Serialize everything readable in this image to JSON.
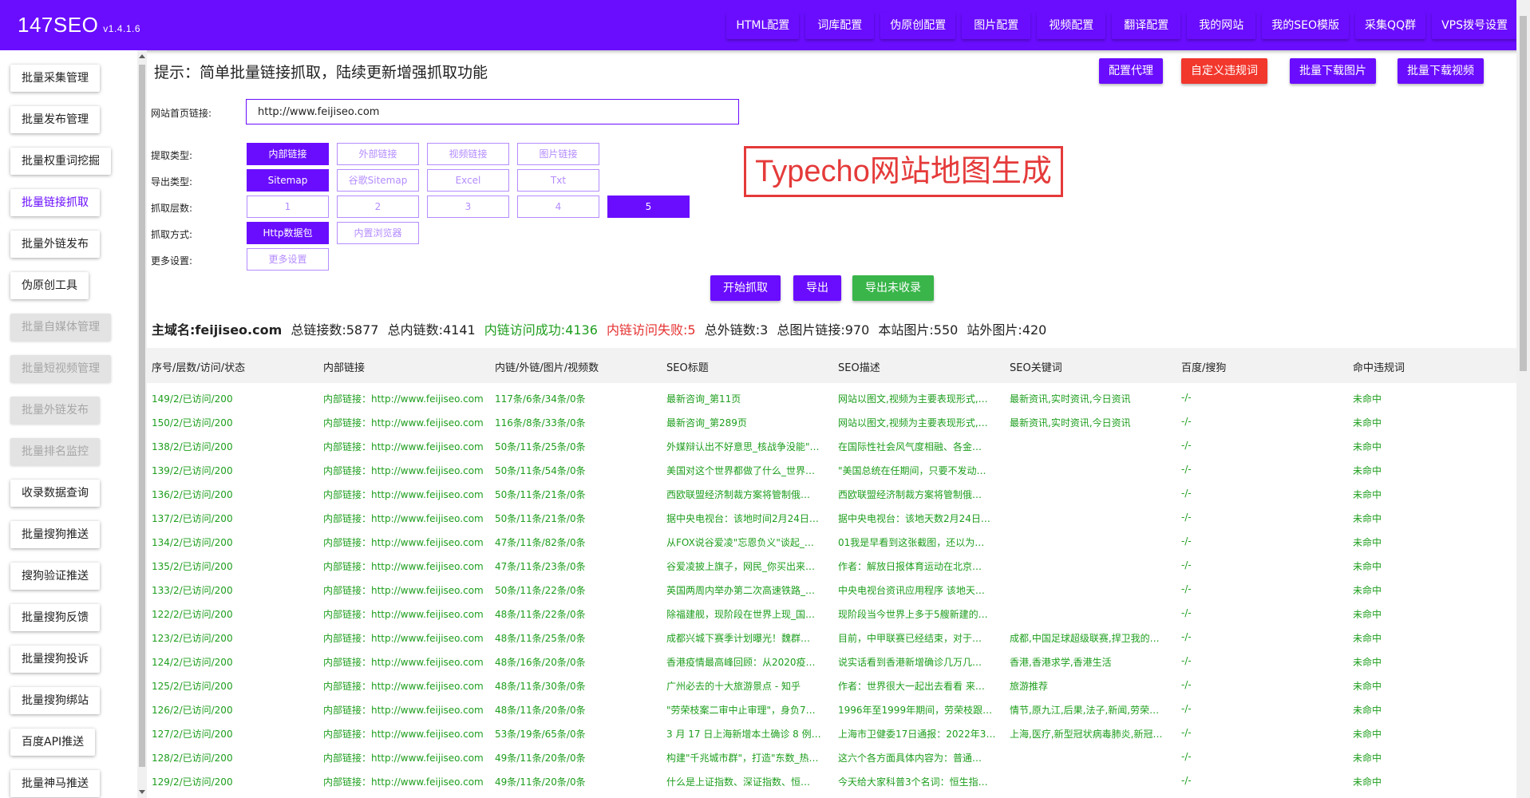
{
  "app": {
    "title": "147SEO",
    "version": "v1.4.1.6"
  },
  "topnav": [
    "HTML配置",
    "词库配置",
    "伪原创配置",
    "图片配置",
    "视频配置",
    "翻译配置",
    "我的网站",
    "我的SEO模版",
    "采集QQ群",
    "VPS拨号设置"
  ],
  "sidebar": {
    "items": [
      {
        "label": "批量采集管理",
        "state": "normal"
      },
      {
        "label": "批量发布管理",
        "state": "normal"
      },
      {
        "label": "批量权重词挖掘",
        "state": "normal"
      },
      {
        "label": "批量链接抓取",
        "state": "active"
      },
      {
        "label": "批量外链发布",
        "state": "normal"
      },
      {
        "label": "伪原创工具",
        "state": "normal"
      },
      {
        "label": "批量自媒体管理",
        "state": "disabled"
      },
      {
        "label": "批量短视频管理",
        "state": "disabled"
      },
      {
        "label": "批量外链发布",
        "state": "disabled"
      },
      {
        "label": "批量排名监控",
        "state": "disabled"
      },
      {
        "label": "收录数据查询",
        "state": "normal"
      },
      {
        "label": "批量搜狗推送",
        "state": "normal"
      },
      {
        "label": "搜狗验证推送",
        "state": "normal"
      },
      {
        "label": "批量搜狗反馈",
        "state": "normal"
      },
      {
        "label": "批量搜狗投诉",
        "state": "normal"
      },
      {
        "label": "批量搜狗绑站",
        "state": "normal"
      },
      {
        "label": "百度API推送",
        "state": "normal"
      },
      {
        "label": "批量神马推送",
        "state": "normal"
      }
    ]
  },
  "header": {
    "tip": "提示：简单批量链接抓取，陆续更新增强抓取功能",
    "actions": [
      "配置代理",
      "自定义违规词",
      "批量下载图片",
      "批量下载视频"
    ]
  },
  "form": {
    "url_label": "网站首页链接:",
    "url_value": "http://www.feijiseo.com",
    "extract_label": "提取类型:",
    "extract_options": [
      "内部链接",
      "外部链接",
      "视频链接",
      "图片链接"
    ],
    "export_label": "导出类型:",
    "export_options": [
      "Sitemap",
      "谷歌Sitemap",
      "Excel",
      "Txt"
    ],
    "depth_label": "抓取层数:",
    "depth_options": [
      "1",
      "2",
      "3",
      "4",
      "5"
    ],
    "method_label": "抓取方式:",
    "method_options": [
      "Http数据包",
      "内置浏览器"
    ],
    "more_label": "更多设置:",
    "more_button": "更多设置"
  },
  "overlay_title": "Typecho网站地图生成",
  "buttons": {
    "start": "开始抓取",
    "export": "导出",
    "export_unindexed": "导出未收录"
  },
  "stats": {
    "domain": "主域名:feijiseo.com",
    "total_links": "总链接数:5877",
    "internal_links": "总内链数:4141",
    "internal_ok": "内链访问成功:4136",
    "internal_fail": "内链访问失败:5",
    "external_links": "总外链数:3",
    "total_images": "总图片链接:970",
    "site_images": "本站图片:550",
    "external_images": "站外图片:420"
  },
  "colors": {
    "brand": "#6a0dff",
    "success": "#1e9e1e",
    "danger": "#e53030",
    "red_button": "#f2372d",
    "green_button": "#39b54a"
  },
  "table": {
    "headers": [
      "序号/层数/访问/状态",
      "内部链接",
      "内链/外链/图片/视频数",
      "SEO标题",
      "SEO描述",
      "SEO关键词",
      "百度/搜狗",
      "命中违规词"
    ],
    "rows": [
      [
        "149/2/已访问/200",
        "内部链接：http://www.feijiseo.com/index",
        "117条/6条/34条/0条",
        "最新咨询_第11页",
        "网站以图文,视频为主要表现形式,…",
        "最新资讯,实时资讯,今日资讯",
        "-/-",
        "未命中"
      ],
      [
        "150/2/已访问/200",
        "内部链接：http://www.feijiseo.com/index",
        "116条/8条/33条/0条",
        "最新咨询_第289页",
        "网站以图文,视频为主要表现形式,…",
        "最新资讯,实时资讯,今日资讯",
        "-/-",
        "未命中"
      ],
      [
        "138/2/已访问/200",
        "内部链接：http://www.feijiseo.com/index",
        "50条/11条/25条/0条",
        "外媒辩认出不好意思_核战争没能\"…",
        "在国际性社会风气度相融、各金…",
        "",
        "-/-",
        "未命中"
      ],
      [
        "139/2/已访问/200",
        "内部链接：http://www.feijiseo.com/index",
        "50条/11条/54条/0条",
        "美国对这个世界都做了什么_世界…",
        "\"美国总统在任期间，只要不发动…",
        "",
        "-/-",
        "未命中"
      ],
      [
        "136/2/已访问/200",
        "内部链接：http://www.feijiseo.com/index",
        "50条/11条/21条/0条",
        "西欧联盟经济制裁方案将管制俄…",
        "西欧联盟经济制裁方案将管制俄…",
        "",
        "-/-",
        "未命中"
      ],
      [
        "137/2/已访问/200",
        "内部链接：http://www.feijiseo.com/index",
        "50条/11条/21条/0条",
        "据中央电视台：该地时间2月24日…",
        "据中央电视台：该地天数2月24日…",
        "",
        "-/-",
        "未命中"
      ],
      [
        "134/2/已访问/200",
        "内部链接：http://www.feijiseo.com/index",
        "47条/11条/82条/0条",
        "从FOX说谷爱凌\"忘恩负义\"谈起_…",
        "01我是早看到这张截图，还以为…",
        "",
        "-/-",
        "未命中"
      ],
      [
        "135/2/已访问/200",
        "内部链接：http://www.feijiseo.com/index",
        "47条/11条/23条/0条",
        "谷爱凌披上旗子，网民_你买出来…",
        "作者：解放日报体育运动在北京…",
        "",
        "-/-",
        "未命中"
      ],
      [
        "133/2/已访问/200",
        "内部链接：http://www.feijiseo.com/index",
        "50条/11条/22条/0条",
        "英国两周内举办第二次高速铁路_…",
        "中央电视台资讯应用程序 该地天…",
        "",
        "-/-",
        "未命中"
      ],
      [
        "122/2/已访问/200",
        "内部链接：http://www.feijiseo.com/index",
        "48条/11条/22条/0条",
        "除福建舰，现阶段在世界上现_国…",
        "现阶段当今世界上多于5艘新建的…",
        "",
        "-/-",
        "未命中"
      ],
      [
        "123/2/已访问/200",
        "内部链接：http://www.feijiseo.com/index",
        "48条/11条/25条/0条",
        "成都兴城下赛季计划曝光！魏群…",
        "目前，中甲联赛已经结束，对于…",
        "成都,中国足球超级联赛,捍卫我的…",
        "-/-",
        "未命中"
      ],
      [
        "124/2/已访问/200",
        "内部链接：http://www.feijiseo.com/index",
        "48条/16条/20条/0条",
        "香港疫情最高峰回顾：从2020疫…",
        "说实话看到香港新增确诊几万几…",
        "香港,香港求学,香港生活",
        "-/-",
        "未命中"
      ],
      [
        "125/2/已访问/200",
        "内部链接：http://www.feijiseo.com/index",
        "48条/11条/30条/0条",
        "广州必去的十大旅游景点 - 知乎",
        "作者：世界很大一起出去看看 来…",
        "旅游推荐",
        "-/-",
        "未命中"
      ],
      [
        "126/2/已访问/200",
        "内部链接：http://www.feijiseo.com/index",
        "48条/11条/20条/0条",
        "\"劳荣枝案二审中止审理\"，身负7…",
        "1996年至1999年期间，劳荣枝跟…",
        "情节,原九江,后果,法子,新闻,劳荣…",
        "-/-",
        "未命中"
      ],
      [
        "127/2/已访问/200",
        "内部链接：http://www.feijiseo.com/index",
        "53条/19条/65条/0条",
        "3 月 17 日上海新增本土确诊 8 例…",
        "上海市卫健委17日通报：2022年3…",
        "上海,医疗,新型冠状病毒肺炎,新冠…",
        "-/-",
        "未命中"
      ],
      [
        "128/2/已访问/200",
        "内部链接：http://www.feijiseo.com/index",
        "49条/11条/20条/0条",
        "构建\"千兆城市群\"，打造\"东数_热…",
        "这六个各方面具体内容为：普通…",
        "",
        "-/-",
        "未命中"
      ],
      [
        "129/2/已访问/200",
        "内部链接：http://www.feijiseo.com/index",
        "49条/11条/20条/0条",
        "什么是上证指数、深证指数、恒…",
        "今天给大家科普3个名词：恒生指…",
        "",
        "-/-",
        "未命中"
      ]
    ]
  }
}
